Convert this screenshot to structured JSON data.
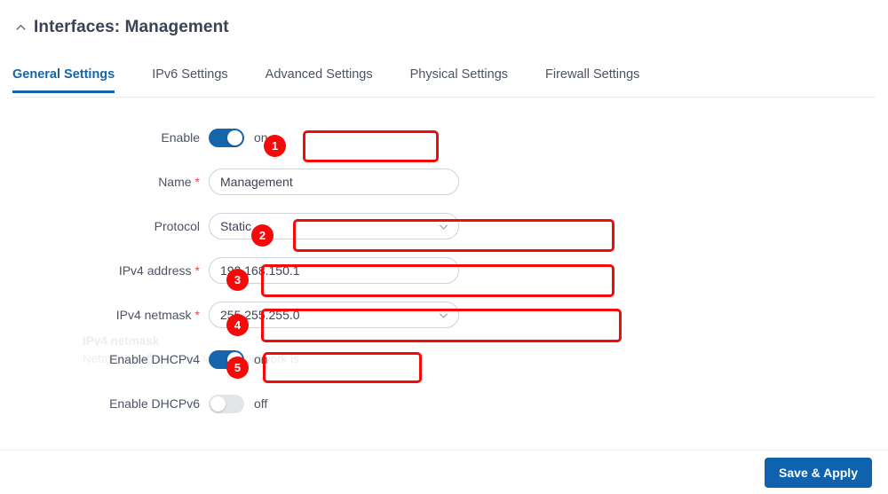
{
  "header": {
    "title": "Interfaces: Management",
    "collapse_icon": "chevron-up-icon"
  },
  "tabs": [
    {
      "label": "General Settings",
      "active": true
    },
    {
      "label": "IPv6 Settings",
      "active": false
    },
    {
      "label": "Advanced Settings",
      "active": false
    },
    {
      "label": "Physical Settings",
      "active": false
    },
    {
      "label": "Firewall Settings",
      "active": false
    }
  ],
  "ghost_tooltip": {
    "title": "IPv4 netmask",
    "body": "Netmask defines how 'large' a network is."
  },
  "form": {
    "enable": {
      "label": "Enable",
      "state_text": "on",
      "checked": true,
      "badge": "1"
    },
    "name": {
      "label": "Name",
      "required": "*",
      "value": "Management"
    },
    "protocol": {
      "label": "Protocol",
      "value": "Static",
      "caret_icon": "chevron-down-icon",
      "badge": "2"
    },
    "ipv4_address": {
      "label": "IPv4 address",
      "required": "*",
      "value": "192.168.150.1",
      "badge": "3"
    },
    "ipv4_netmask": {
      "label": "IPv4 netmask",
      "required": "*",
      "value": "255.255.255.0",
      "caret_icon": "chevron-down-icon",
      "badge": "4"
    },
    "enable_dhcpv4": {
      "label": "Enable DHCPv4",
      "state_text": "on",
      "checked": true,
      "badge": "5"
    },
    "enable_dhcpv6": {
      "label": "Enable DHCPv6",
      "state_text": "off",
      "checked": false
    }
  },
  "footer": {
    "save_label": "Save & Apply"
  },
  "colors": {
    "accent_blue": "#1565ad",
    "button_blue": "#0f62ad",
    "annotation_red": "#f50a0a",
    "required_red": "#e34a4a",
    "toggle_off_grey": "#e3e5e9"
  }
}
